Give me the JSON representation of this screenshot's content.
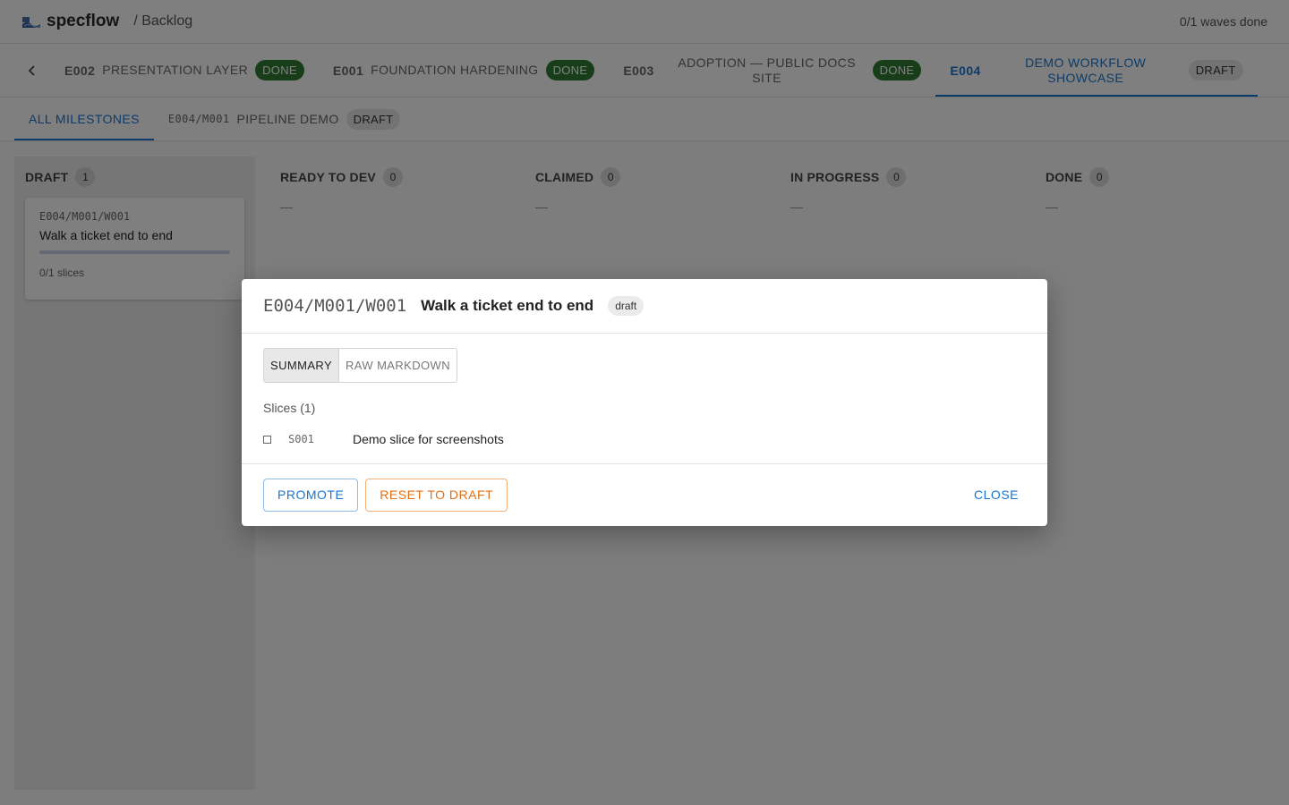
{
  "app": {
    "name": "specflow",
    "breadcrumb": "/ Backlog",
    "waves_status": "0/1 waves done"
  },
  "colors": {
    "accent": "#1976d2",
    "done": "#2e7d32",
    "warning": "#e0701a"
  },
  "epic_tabs": [
    {
      "id": "E002",
      "title": "PRESENTATION LAYER",
      "status": "DONE"
    },
    {
      "id": "E001",
      "title": "FOUNDATION HARDENING",
      "status": "DONE"
    },
    {
      "id": "E003",
      "title": "ADOPTION — PUBLIC DOCS SITE",
      "status": "DONE"
    },
    {
      "id": "E004",
      "title": "DEMO WORKFLOW SHOWCASE",
      "status": "DRAFT",
      "active": true
    }
  ],
  "milestone_tabs": {
    "all_label": "ALL MILESTONES",
    "items": [
      {
        "id": "E004/M001",
        "title": "PIPELINE DEMO",
        "status": "DRAFT"
      }
    ]
  },
  "columns": [
    {
      "title": "DRAFT",
      "count": "1"
    },
    {
      "title": "READY TO DEV",
      "count": "0",
      "empty": "—"
    },
    {
      "title": "CLAIMED",
      "count": "0",
      "empty": "—"
    },
    {
      "title": "IN PROGRESS",
      "count": "0",
      "empty": "—"
    },
    {
      "title": "DONE",
      "count": "0",
      "empty": "—"
    }
  ],
  "card": {
    "id": "E004/M001/W001",
    "title": "Walk a ticket end to end",
    "slices": "0/1 slices",
    "progress": 0
  },
  "dialog": {
    "id": "E004/M001/W001",
    "title": "Walk a ticket end to end",
    "status": "draft",
    "tabs": {
      "summary": "SUMMARY",
      "raw": "RAW MARKDOWN"
    },
    "slices_label": "Slices (1)",
    "slices": [
      {
        "id": "S001",
        "title": "Demo slice for screenshots",
        "checked": false
      }
    ],
    "buttons": {
      "promote": "PROMOTE",
      "reset": "RESET TO DRAFT",
      "close": "CLOSE"
    }
  },
  "icons": {
    "back": "chevron-left-icon",
    "logo": "wave-logo-icon"
  }
}
